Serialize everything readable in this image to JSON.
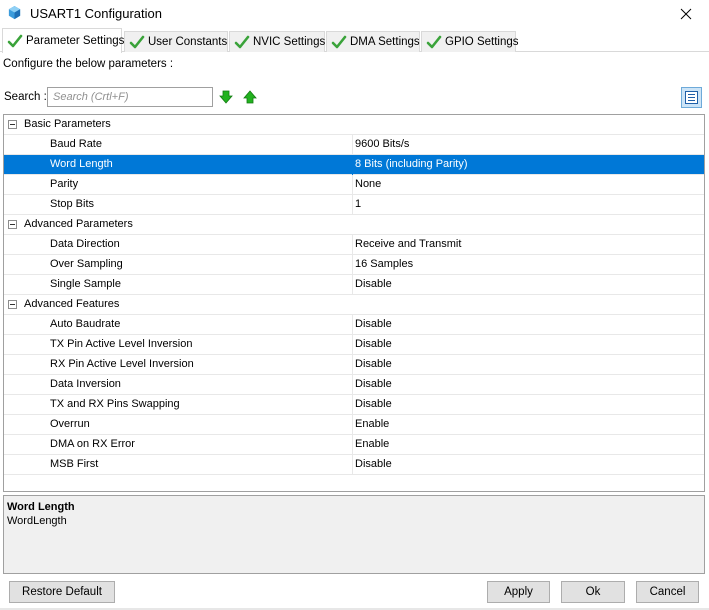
{
  "window": {
    "title": "USART1 Configuration",
    "app_icon": "cube-icon",
    "close_icon": "close-icon"
  },
  "tabs": [
    {
      "label": "Parameter Settings",
      "active": true,
      "icon": "green-check-icon"
    },
    {
      "label": "User Constants",
      "active": false,
      "icon": "green-check-icon"
    },
    {
      "label": "NVIC Settings",
      "active": false,
      "icon": "green-check-icon"
    },
    {
      "label": "DMA Settings",
      "active": false,
      "icon": "green-check-icon"
    },
    {
      "label": "GPIO Settings",
      "active": false,
      "icon": "green-check-icon"
    }
  ],
  "main": {
    "configure_label": "Configure the below parameters :",
    "search": {
      "label": "Search :",
      "placeholder": "Search (Crtl+F)",
      "value": ""
    },
    "toolbar_icons": [
      "arrow-down-green-icon",
      "arrow-up-green-icon",
      "list-view-icon"
    ]
  },
  "groups": [
    {
      "label": "Basic Parameters",
      "params": [
        {
          "name": "Baud Rate",
          "value": "9600 Bits/s",
          "selected": false
        },
        {
          "name": "Word Length",
          "value": "8 Bits (including Parity)",
          "selected": true
        },
        {
          "name": "Parity",
          "value": "None",
          "selected": false
        },
        {
          "name": "Stop Bits",
          "value": "1",
          "selected": false
        }
      ]
    },
    {
      "label": "Advanced Parameters",
      "params": [
        {
          "name": "Data Direction",
          "value": "Receive and Transmit",
          "selected": false
        },
        {
          "name": "Over Sampling",
          "value": "16 Samples",
          "selected": false
        },
        {
          "name": "Single Sample",
          "value": "Disable",
          "selected": false
        }
      ]
    },
    {
      "label": "Advanced Features",
      "params": [
        {
          "name": "Auto Baudrate",
          "value": "Disable",
          "selected": false
        },
        {
          "name": "TX Pin Active Level Inversion",
          "value": "Disable",
          "selected": false
        },
        {
          "name": "RX Pin Active Level Inversion",
          "value": "Disable",
          "selected": false
        },
        {
          "name": "Data Inversion",
          "value": "Disable",
          "selected": false
        },
        {
          "name": "TX and RX Pins Swapping",
          "value": "Disable",
          "selected": false
        },
        {
          "name": "Overrun",
          "value": "Enable",
          "selected": false
        },
        {
          "name": "DMA on RX Error",
          "value": "Enable",
          "selected": false
        },
        {
          "name": "MSB First",
          "value": "Disable",
          "selected": false
        }
      ]
    }
  ],
  "description": {
    "title": "Word Length",
    "text": "WordLength"
  },
  "buttons": {
    "restore_default": "Restore Default",
    "apply": "Apply",
    "ok": "Ok",
    "cancel": "Cancel"
  },
  "colors": {
    "selection": "#0078d7",
    "check_green": "#3aa33a",
    "arrow_green": "#22b21f"
  }
}
